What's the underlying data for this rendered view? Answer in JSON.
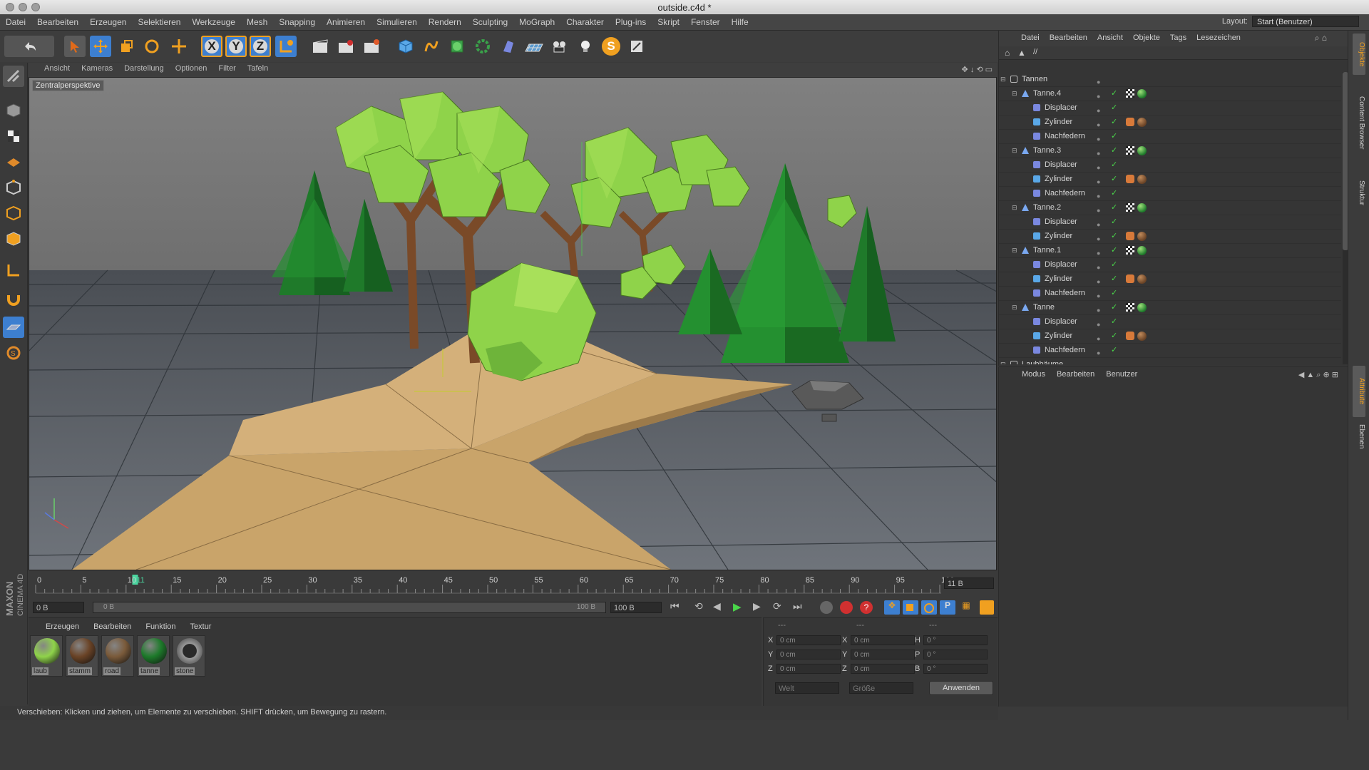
{
  "window": {
    "title": "outside.c4d *"
  },
  "menubar": {
    "items": [
      "Datei",
      "Bearbeiten",
      "Erzeugen",
      "Selektieren",
      "Werkzeuge",
      "Mesh",
      "Snapping",
      "Animieren",
      "Simulieren",
      "Rendern",
      "Sculpting",
      "MoGraph",
      "Charakter",
      "Plug-ins",
      "Skript",
      "Fenster",
      "Hilfe"
    ],
    "layout_label": "Layout:",
    "layout_value": "Start (Benutzer)"
  },
  "toolbar": {
    "axis_x": "X",
    "axis_y": "Y",
    "axis_z": "Z",
    "icons": [
      "undo-icon",
      "select-arrow-icon",
      "move-icon",
      "scale-icon",
      "rotate-icon",
      "live-select-icon",
      "axis-x-icon",
      "axis-y-icon",
      "axis-z-icon",
      "coordinate-system-icon",
      "render-view-icon",
      "render-picture-viewer-icon",
      "render-settings-icon",
      "cube-icon",
      "spline-pen-icon",
      "subdivision-surface-icon",
      "array-icon",
      "deformer-icon",
      "floor-icon",
      "camera-icon",
      "light-icon",
      "sketch-icon",
      "scene-icon"
    ]
  },
  "viewport": {
    "menus": [
      "Ansicht",
      "Kameras",
      "Darstellung",
      "Optionen",
      "Filter",
      "Tafeln"
    ],
    "camera_label": "Zentralperspektive"
  },
  "timeline": {
    "ticks": [
      "0",
      "5",
      "10",
      "11",
      "15",
      "20",
      "25",
      "30",
      "35",
      "40",
      "45",
      "50",
      "55",
      "60",
      "65",
      "70",
      "75",
      "80",
      "85",
      "90",
      "95",
      "100"
    ],
    "current_frame_marker": 11,
    "current_frame_field": "11 B",
    "start_field": "0 B",
    "range_start": "0 B",
    "range_end": "100 B",
    "end_field": "100 B"
  },
  "material_manager": {
    "menus": [
      "Erzeugen",
      "Bearbeiten",
      "Funktion",
      "Textur"
    ],
    "materials": [
      {
        "name": "laub",
        "color": "#8fd34a"
      },
      {
        "name": "stamm",
        "color": "#6a4326"
      },
      {
        "name": "road",
        "color": "#7a5a3a"
      },
      {
        "name": "tanne",
        "color": "#1d7a2a"
      },
      {
        "name": "stone",
        "color": "#5e5e5e"
      }
    ]
  },
  "coordinates": {
    "header_a": "---",
    "header_b": "---",
    "header_c": "---",
    "rows": [
      {
        "l1": "X",
        "v1": "0 cm",
        "l2": "X",
        "v2": "0 cm",
        "l3": "H",
        "v3": "0 °"
      },
      {
        "l1": "Y",
        "v1": "0 cm",
        "l2": "Y",
        "v2": "0 cm",
        "l3": "P",
        "v3": "0 °"
      },
      {
        "l1": "Z",
        "v1": "0 cm",
        "l2": "Z",
        "v2": "0 cm",
        "l3": "B",
        "v3": "0 °"
      }
    ],
    "mode_select": "Welt",
    "size_select": "Größe",
    "apply_button": "Anwenden"
  },
  "status_bar": {
    "text": "Verschieben: Klicken und ziehen, um Elemente zu verschieben. SHIFT drücken, um Bewegung zu rastern."
  },
  "branding": {
    "logo_text": "MAXON CINEMA 4D"
  },
  "object_manager": {
    "menus": [
      "Datei",
      "Bearbeiten",
      "Ansicht",
      "Objekte",
      "Tags",
      "Lesezeichen"
    ],
    "path": "//",
    "rows": [
      {
        "name": "Tannen",
        "level": 0,
        "type": "null"
      },
      {
        "name": "Tanne.4",
        "level": 1,
        "type": "lathe"
      },
      {
        "name": "Displacer",
        "level": 2,
        "type": "deformer"
      },
      {
        "name": "Zylinder",
        "level": 2,
        "type": "primitive"
      },
      {
        "name": "Nachfedern",
        "level": 2,
        "type": "deformer"
      },
      {
        "name": "Tanne.3",
        "level": 1,
        "type": "lathe"
      },
      {
        "name": "Displacer",
        "level": 2,
        "type": "deformer"
      },
      {
        "name": "Zylinder",
        "level": 2,
        "type": "primitive"
      },
      {
        "name": "Nachfedern",
        "level": 2,
        "type": "deformer"
      },
      {
        "name": "Tanne.2",
        "level": 1,
        "type": "lathe"
      },
      {
        "name": "Displacer",
        "level": 2,
        "type": "deformer"
      },
      {
        "name": "Zylinder",
        "level": 2,
        "type": "primitive"
      },
      {
        "name": "Tanne.1",
        "level": 1,
        "type": "lathe"
      },
      {
        "name": "Displacer",
        "level": 2,
        "type": "deformer"
      },
      {
        "name": "Zylinder",
        "level": 2,
        "type": "primitive"
      },
      {
        "name": "Nachfedern",
        "level": 2,
        "type": "deformer"
      },
      {
        "name": "Tanne",
        "level": 1,
        "type": "lathe"
      },
      {
        "name": "Displacer",
        "level": 2,
        "type": "deformer"
      },
      {
        "name": "Zylinder",
        "level": 2,
        "type": "primitive"
      },
      {
        "name": "Nachfedern",
        "level": 2,
        "type": "deformer"
      },
      {
        "name": "Laubbäume",
        "level": 0,
        "type": "null"
      }
    ]
  },
  "attribute_manager": {
    "menus": [
      "Modus",
      "Bearbeiten",
      "Benutzer"
    ]
  },
  "right_tabs": [
    "Objekte",
    "Content Browser",
    "Struktur",
    "Attribute",
    "Ebenen"
  ],
  "colors": {
    "accent_orange": "#f0a020",
    "active_blue": "#3d7fd0",
    "check_green": "#4ad64a",
    "road": "#c9a46a",
    "foliage_light": "#8fd34a",
    "pine_dark": "#1f7a2a",
    "trunk": "#7a4a28"
  }
}
